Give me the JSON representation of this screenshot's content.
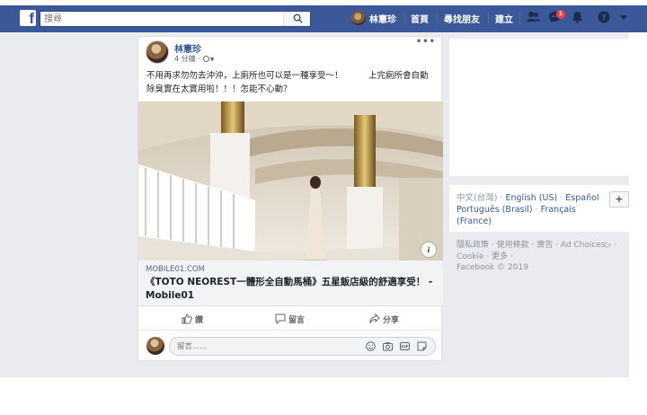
{
  "topbar": {
    "logo": "f",
    "search_placeholder": "搜尋",
    "user_name": "林憲珍",
    "home": "首頁",
    "find_friends": "尋找朋友",
    "create": "建立",
    "notification_count": "1",
    "bg_color": "#3b5998"
  },
  "post": {
    "author": "林憲珍",
    "timestamp": "4 分鐘 ·",
    "more": "•••",
    "text": "不用再求勿勿去沖沖，上廁所也可以是一種享受～！　　　上完廁所會自動除臭實在太實用啦！！！怎能不心動？",
    "link": {
      "domain": "MOBILE01.COM",
      "title": "《TOTO NEOREST一體形全自動馬桶》五星飯店級的舒適享受！ - Mobile01"
    },
    "info": "i",
    "actions": {
      "like": "讚",
      "comment": "留言",
      "share": "分享"
    },
    "comment_placeholder": "留言......"
  },
  "sidebar": {
    "languages": {
      "current": "中文(台灣)",
      "items": [
        "English (US)",
        "Español",
        "Português (Brasil)",
        "Français (France)"
      ],
      "plus": "+"
    },
    "footer_links": [
      "隱私政策",
      "使用條款",
      "廣告",
      "Ad Choices",
      "Cookie",
      "更多"
    ],
    "copyright": "Facebook © 2019"
  }
}
